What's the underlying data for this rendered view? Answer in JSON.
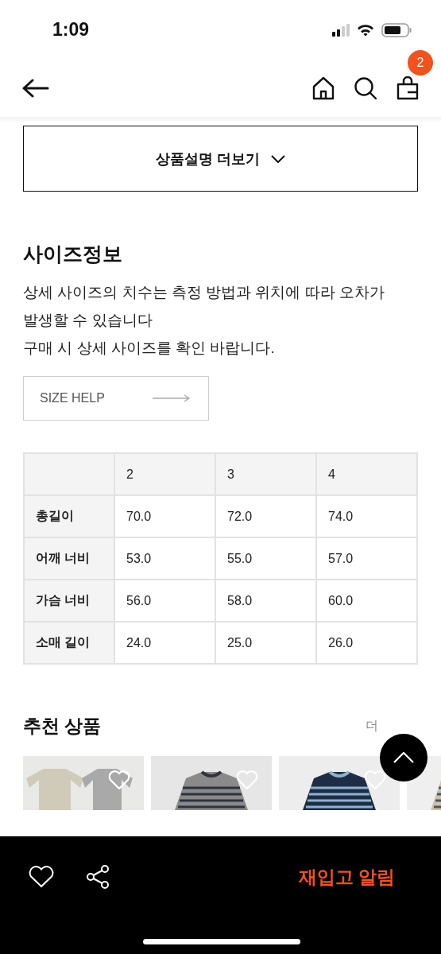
{
  "status_bar": {
    "time": "1:09"
  },
  "nav": {
    "cart_count": "2"
  },
  "more_button": {
    "label": "상품설명 더보기"
  },
  "size_info": {
    "title": "사이즈정보",
    "description_lines": [
      "상세 사이즈의 치수는 측정 방법과 위치에 따라 오차가",
      "발생할 수 있습니다",
      "구매 시 상세 사이즈를 확인 바랍니다."
    ],
    "help_button": {
      "label": "SIZE HELP"
    },
    "table": {
      "columns": [
        "2",
        "3",
        "4"
      ],
      "rows": [
        {
          "label": "총길이",
          "values": [
            "70.0",
            "72.0",
            "74.0"
          ]
        },
        {
          "label": "어깨 너비",
          "values": [
            "53.0",
            "55.0",
            "57.0"
          ]
        },
        {
          "label": "가슴 너비",
          "values": [
            "56.0",
            "58.0",
            "60.0"
          ]
        },
        {
          "label": "소매 길이",
          "values": [
            "24.0",
            "25.0",
            "26.0"
          ]
        }
      ]
    }
  },
  "recommended": {
    "title": "추천 상품",
    "more_link": "더"
  },
  "bottom_bar": {
    "restock_button": "재입고 알림"
  }
}
